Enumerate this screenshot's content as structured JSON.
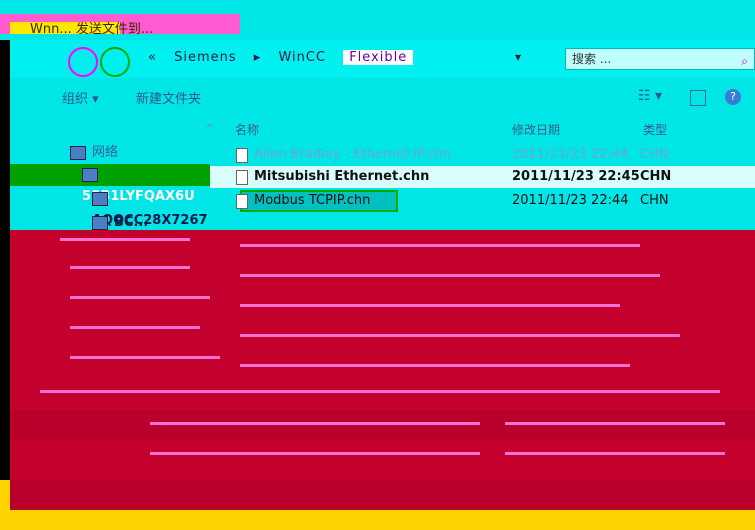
{
  "window": {
    "title": "Wnn... 发送文件到..."
  },
  "addressbar": {
    "crumbs": [
      "«",
      "Siemens",
      "▸",
      "WinCC"
    ],
    "highlight": "Flexible",
    "search_placeholder": "搜索 ..."
  },
  "toolbar": {
    "organize_label": "组织 ▾",
    "new_folder_label": "新建文件夹",
    "view_label": "☷ ▾",
    "help_label": "?"
  },
  "columns": {
    "name": "名称",
    "date": "修改日期",
    "type": "类型"
  },
  "nav": {
    "network_label": "网络",
    "computers": [
      "5SB1LYFQAX6U",
      "AQOCC28X7267",
      "BC..."
    ]
  },
  "files": [
    {
      "name": "Allen Bradley - Ethernet IP.chn",
      "date": "2011/11/23 22:44",
      "type": "CHN"
    },
    {
      "name": "Mitsubishi Ethernet.chn",
      "date": "2011/11/23 22:45",
      "type": "CHN"
    },
    {
      "name": "Modbus TCPIP.chn",
      "date": "2011/11/23 22:44",
      "type": "CHN"
    }
  ],
  "colors": {
    "cyan": "#00e6e6",
    "magenta": "#ff5ad0",
    "crimson": "#c4002c",
    "yellow": "#ffd400",
    "selection_green": "#00a000"
  }
}
